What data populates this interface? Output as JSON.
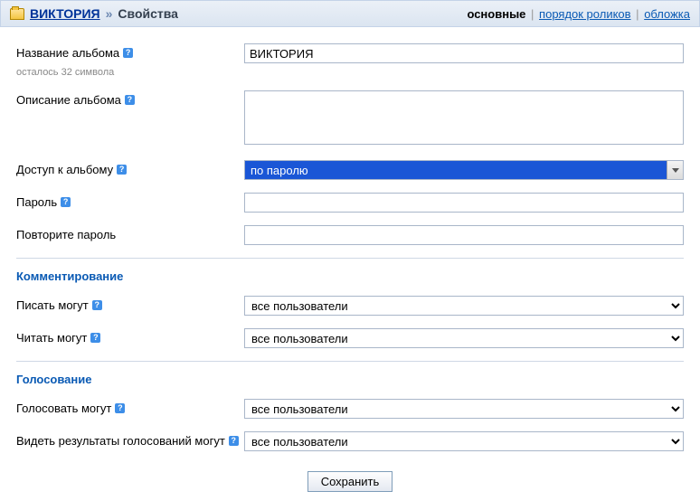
{
  "header": {
    "album_link": "ВИКТОРИЯ",
    "separator": "»",
    "current": "Свойства",
    "tabs": {
      "active": "основные",
      "order": "порядок роликов",
      "cover": "обложка"
    }
  },
  "fields": {
    "name_label": "Название альбома",
    "name_value": "ВИКТОРИЯ",
    "name_hint": "осталось 32 символа",
    "desc_label": "Описание альбома",
    "desc_value": "",
    "access_label": "Доступ к альбому",
    "access_value": "по паролю",
    "password_label": "Пароль",
    "password_value": "",
    "password2_label": "Повторите пароль",
    "password2_value": ""
  },
  "sections": {
    "commenting": {
      "title": "Комментирование",
      "write_label": "Писать могут",
      "write_value": "все пользователи",
      "read_label": "Читать могут",
      "read_value": "все пользователи"
    },
    "voting": {
      "title": "Голосование",
      "vote_label": "Голосовать могут",
      "vote_value": "все пользователи",
      "results_label": "Видеть результаты голосований могут",
      "results_value": "все пользователи"
    }
  },
  "submit_label": "Сохранить",
  "help_glyph": "?"
}
